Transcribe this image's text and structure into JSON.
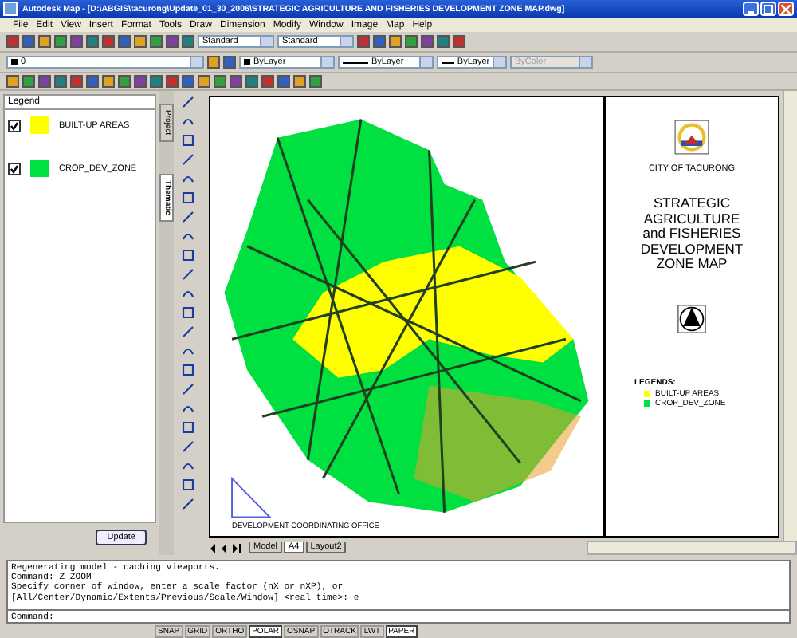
{
  "window": {
    "title": "Autodesk Map - [D:\\ABGIS\\tacurong\\Update_01_30_2006\\STRATEGIC AGRICULTURE AND FISHERIES DEVELOPMENT ZONE MAP.dwg]"
  },
  "menu": [
    "File",
    "Edit",
    "View",
    "Insert",
    "Format",
    "Tools",
    "Draw",
    "Dimension",
    "Modify",
    "Window",
    "Image",
    "Map",
    "Help"
  ],
  "toolbar": {
    "text_style": "Standard",
    "dim_style": "Standard",
    "layer": "0",
    "color_setting": "ByLayer",
    "linetype": "ByLayer",
    "lineweight": "ByLayer",
    "plot_style": {
      "value": "ByColor",
      "disabled": true
    }
  },
  "legend_panel": {
    "title": "Legend",
    "items": [
      {
        "label": "BUILT-UP AREAS",
        "checked": true,
        "color": "#ffff00"
      },
      {
        "label": "CROP_DEV_ZONE",
        "checked": true,
        "color": "#00e040"
      }
    ],
    "button": "Update"
  },
  "side_tabs": [
    {
      "label": "Project",
      "selected": false
    },
    {
      "label": "Thematic",
      "selected": true
    }
  ],
  "title_block": {
    "city": "CITY OF TACURONG",
    "map_title": [
      "STRATEGIC",
      "AGRICULTURE",
      "and FISHERIES",
      "DEVELOPMENT",
      "ZONE MAP"
    ],
    "legend_title": "LEGENDS:",
    "legend": [
      {
        "label": "BUILT-UP AREAS",
        "color": "#ffff00"
      },
      {
        "label": "CROP_DEV_ZONE",
        "color": "#00e040"
      }
    ]
  },
  "map_footer": "DEVELOPMENT COORDINATING OFFICE",
  "layout_tabs": [
    {
      "label": "Model",
      "selected": false
    },
    {
      "label": "A4",
      "selected": true
    },
    {
      "label": "Layout2",
      "selected": false
    }
  ],
  "command_history": [
    "Regenerating model - caching viewports.",
    "Command: Z ZOOM",
    "Specify corner of window, enter a scale factor (nX or nXP), or",
    "[All/Center/Dynamic/Extents/Previous/Scale/Window] <real time>: e"
  ],
  "command_prompt": "Command:",
  "status_buttons": [
    {
      "label": "SNAP",
      "on": false
    },
    {
      "label": "GRID",
      "on": false
    },
    {
      "label": "ORTHO",
      "on": false
    },
    {
      "label": "POLAR",
      "on": true
    },
    {
      "label": "OSNAP",
      "on": false
    },
    {
      "label": "OTRACK",
      "on": false
    },
    {
      "label": "LWT",
      "on": false
    },
    {
      "label": "PAPER",
      "on": true
    }
  ]
}
